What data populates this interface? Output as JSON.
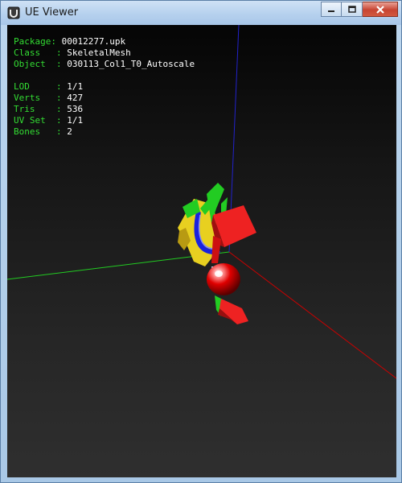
{
  "window": {
    "title": "UE Viewer"
  },
  "info": {
    "package": {
      "label": "Package: ",
      "value": "00012277.upk"
    },
    "class": {
      "label": "Class   : ",
      "value": "SkeletalMesh"
    },
    "object": {
      "label": "Object  : ",
      "value": "030113_Col1_T0_Autoscale"
    },
    "lod": {
      "label": "LOD     : ",
      "value": "1/1"
    },
    "verts": {
      "label": "Verts   : ",
      "value": "427"
    },
    "tris": {
      "label": "Tris    : ",
      "value": "536"
    },
    "uvset": {
      "label": "UV Set  : ",
      "value": "1/1"
    },
    "bones": {
      "label": "Bones   : ",
      "value": "2"
    }
  },
  "colors": {
    "label": "#33dd33",
    "value": "#ffffff",
    "axis_x": "#cc0000",
    "axis_y": "#22cc22",
    "axis_z": "#2222cc"
  }
}
